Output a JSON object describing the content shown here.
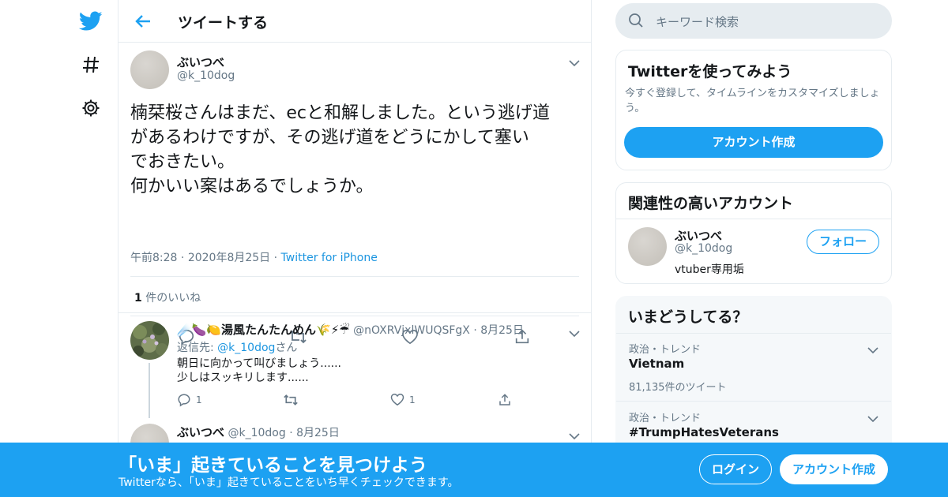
{
  "colors": {
    "accent": "#1da1f2",
    "link": "#1b95e0",
    "muted": "#657786",
    "border": "#e6ecf0"
  },
  "nav": {
    "icons": [
      "twitter-logo-icon",
      "hashtag-icon",
      "gear-icon"
    ]
  },
  "header": {
    "title": "ツイートする"
  },
  "tweet": {
    "name": "ぶいつべ",
    "handle": "@k_10dog",
    "body_lines": [
      "楠栞桜さんはまだ、ecと和解しました。という逃げ道",
      "があるわけですが、その逃げ道をどうにかして塞い",
      "でおきたい。",
      "何かいい案はあるでしょうか。"
    ],
    "time": "午前8:28",
    "date": "2020年8月25日",
    "source": "Twitter for iPhone",
    "likes_count": "1",
    "likes_label": "件のいいね"
  },
  "replies": [
    {
      "emoji_prefix": "☄️🍆🍋",
      "name": "湯風たんたんめん",
      "emoji_suffix": "🌾⚡☔",
      "handle": "@nOXRVjxlWUQSFgX",
      "date": "8月25日",
      "reply_to_label": "返信先:",
      "reply_to_handle": "@k_10dog",
      "reply_to_suffix": "さん",
      "text_lines": [
        "朝日に向かって叫びましょう......",
        "少しはスッキリします......"
      ],
      "reply_count": "1",
      "like_count": "1"
    },
    {
      "name": "ぶいつべ",
      "handle": "@k_10dog",
      "date": "8月25日"
    }
  ],
  "search": {
    "placeholder": "キーワード検索"
  },
  "signup_card": {
    "title": "Twitterを使ってみよう",
    "desc_line1": "今すぐ登録して、タイムラインをカスタマイズしましょ",
    "desc_line2": "う。",
    "button": "アカウント作成"
  },
  "related_card": {
    "title": "関連性の高いアカウント",
    "name": "ぶいつべ",
    "handle": "@k_10dog",
    "bio": "vtuber専用垢",
    "follow": "フォロー"
  },
  "trends_card": {
    "title": "いまどうしてる？",
    "items": [
      {
        "category": "政治・トレンド",
        "name": "Vietnam",
        "count": "81,135件のツイート"
      },
      {
        "category": "政治・トレンド",
        "name": "#TrumpHatesVeterans"
      }
    ]
  },
  "banner": {
    "title": "「いま」起きていることを見つけよう",
    "subtitle": "Twitterなら、「いま」起きていることをいち早くチェックできます。",
    "login": "ログイン",
    "signup": "アカウント作成"
  }
}
